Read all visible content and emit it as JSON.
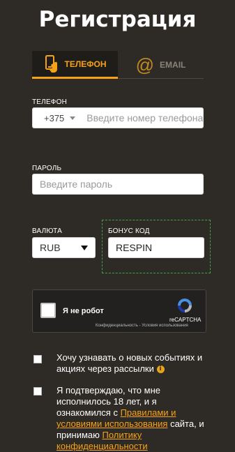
{
  "title": "Регистрация",
  "tabs": [
    {
      "label": "ТЕЛЕФОН",
      "active": true,
      "icon": "phone-hand-icon"
    },
    {
      "label": "EMAIL",
      "active": false,
      "icon": "at-icon"
    }
  ],
  "phone": {
    "label": "ТЕЛЕФОН",
    "country_code": "+375",
    "placeholder": "Введите номер телефона",
    "flag": "belarus-flag-icon"
  },
  "password": {
    "label": "ПАРОЛЬ",
    "placeholder": "Введите пароль"
  },
  "currency": {
    "label": "ВАЛЮТА",
    "value": "RUB"
  },
  "bonus": {
    "label": "БОНУС КОД",
    "value": "RESPIN"
  },
  "captcha": {
    "text": "Я не робот",
    "brand": "reCAPTCHA",
    "links": "Конфиденциальность - Условия использования"
  },
  "newsletter": {
    "text": "Хочу узнавать о новых событиях и акциях через рассылки",
    "info_icon": "i"
  },
  "terms": {
    "text_1": "Я подтверждаю, что мне исполнилось 18 лет, и я ознакомился с ",
    "link_1": "Правилами и условиями использования",
    "text_2": " сайта, и принимаю ",
    "link_2": "Политику конфиденциальности"
  },
  "colors": {
    "background": "#2e2b27",
    "accent": "#f7a116",
    "bonus_border": "#3da44a"
  }
}
